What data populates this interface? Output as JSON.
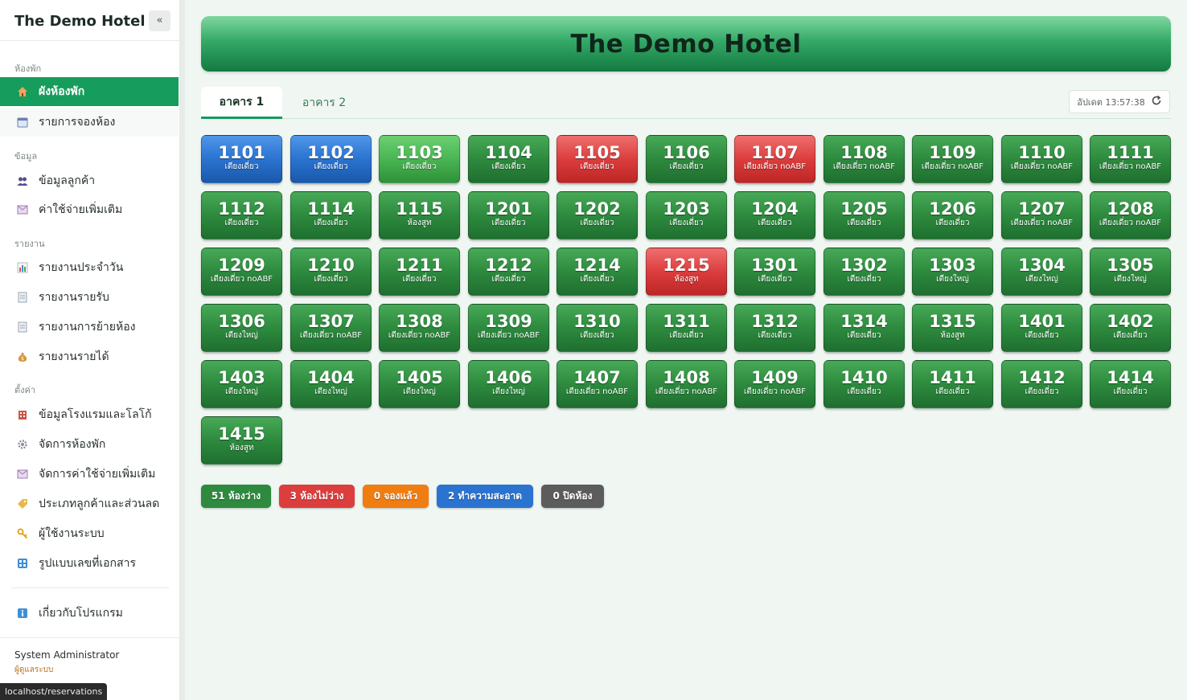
{
  "sidebar": {
    "brand": "The Demo Hotel",
    "collapse": "«",
    "sections": {
      "rooms": "ห้องพัก",
      "data": "ข้อมูล",
      "reports": "รายงาน",
      "settings": "ตั้งค่า"
    },
    "items": [
      {
        "label": "ผังห้องพัก",
        "icon": "house-icon"
      },
      {
        "label": "รายการจองห้อง",
        "icon": "calendar-icon"
      },
      {
        "label": "ข้อมูลลูกค้า",
        "icon": "people-icon"
      },
      {
        "label": "ค่าใช้จ่ายเพิ่มเติม",
        "icon": "receipt-icon"
      },
      {
        "label": "รายงานประจำวัน",
        "icon": "bar-chart-icon"
      },
      {
        "label": "รายงานรายรับ",
        "icon": "document-icon"
      },
      {
        "label": "รายงานการย้ายห้อง",
        "icon": "document-icon"
      },
      {
        "label": "รายงานรายได้",
        "icon": "money-bag-icon"
      },
      {
        "label": "ข้อมูลโรงแรมและโลโก้",
        "icon": "hotel-icon"
      },
      {
        "label": "จัดการห้องพัก",
        "icon": "gear-icon"
      },
      {
        "label": "จัดการค่าใช้จ่ายเพิ่มเติม",
        "icon": "receipt-icon"
      },
      {
        "label": "ประเภทลูกค้าและส่วนลด",
        "icon": "tag-icon"
      },
      {
        "label": "ผู้ใช้งานระบบ",
        "icon": "key-icon"
      },
      {
        "label": "รูปแบบเลขที่เอกสาร",
        "icon": "numbers-icon"
      },
      {
        "label": "เกี่ยวกับโปรแกรม",
        "icon": "info-icon"
      }
    ],
    "user": {
      "name": "System Administrator",
      "role": "ผู้ดูแลระบบ"
    },
    "status_url": "localhost/reservations"
  },
  "header": {
    "title": "The Demo Hotel"
  },
  "tabs": [
    {
      "label": "อาคาร 1"
    },
    {
      "label": "อาคาร 2"
    }
  ],
  "update": {
    "label": "อัปเดต 13:57:38"
  },
  "colors": {
    "available": "#2d8a3e",
    "available_light": "#49b553",
    "occupied": "#dc3d3d",
    "cleaning": "#2a73d0",
    "reserved": "#f07d12",
    "closed": "#5c5c5c",
    "accent": "#169c5c"
  },
  "rooms": [
    {
      "number": "1101",
      "type": "เตียงเดี่ยว",
      "status": "blue"
    },
    {
      "number": "1102",
      "type": "เตียงเดี่ยว",
      "status": "blue"
    },
    {
      "number": "1103",
      "type": "เตียงเดี่ยว",
      "status": "green-light"
    },
    {
      "number": "1104",
      "type": "เตียงเดี่ยว",
      "status": "green"
    },
    {
      "number": "1105",
      "type": "เตียงเดี่ยว",
      "status": "red"
    },
    {
      "number": "1106",
      "type": "เตียงเดี่ยว",
      "status": "green"
    },
    {
      "number": "1107",
      "type": "เตียงเดี่ยว noABF",
      "status": "red"
    },
    {
      "number": "1108",
      "type": "เตียงเดี่ยว noABF",
      "status": "green"
    },
    {
      "number": "1109",
      "type": "เตียงเดี่ยว noABF",
      "status": "green"
    },
    {
      "number": "1110",
      "type": "เตียงเดี่ยว noABF",
      "status": "green"
    },
    {
      "number": "1111",
      "type": "เตียงเดี่ยว noABF",
      "status": "green"
    },
    {
      "number": "1112",
      "type": "เตียงเดี่ยว",
      "status": "green"
    },
    {
      "number": "1114",
      "type": "เตียงเดี่ยว",
      "status": "green"
    },
    {
      "number": "1115",
      "type": "ห้องสูท",
      "status": "green"
    },
    {
      "number": "1201",
      "type": "เตียงเดี่ยว",
      "status": "green"
    },
    {
      "number": "1202",
      "type": "เตียงเดี่ยว",
      "status": "green"
    },
    {
      "number": "1203",
      "type": "เตียงเดี่ยว",
      "status": "green"
    },
    {
      "number": "1204",
      "type": "เตียงเดี่ยว",
      "status": "green"
    },
    {
      "number": "1205",
      "type": "เตียงเดี่ยว",
      "status": "green"
    },
    {
      "number": "1206",
      "type": "เตียงเดี่ยว",
      "status": "green"
    },
    {
      "number": "1207",
      "type": "เตียงเดี่ยว noABF",
      "status": "green"
    },
    {
      "number": "1208",
      "type": "เตียงเดี่ยว noABF",
      "status": "green"
    },
    {
      "number": "1209",
      "type": "เตียงเดี่ยว noABF",
      "status": "green"
    },
    {
      "number": "1210",
      "type": "เตียงเดี่ยว",
      "status": "green"
    },
    {
      "number": "1211",
      "type": "เตียงเดี่ยว",
      "status": "green"
    },
    {
      "number": "1212",
      "type": "เตียงเดี่ยว",
      "status": "green"
    },
    {
      "number": "1214",
      "type": "เตียงเดี่ยว",
      "status": "green"
    },
    {
      "number": "1215",
      "type": "ห้องสูท",
      "status": "red"
    },
    {
      "number": "1301",
      "type": "เตียงเดี่ยว",
      "status": "green"
    },
    {
      "number": "1302",
      "type": "เตียงเดี่ยว",
      "status": "green"
    },
    {
      "number": "1303",
      "type": "เตียงใหญ่",
      "status": "green"
    },
    {
      "number": "1304",
      "type": "เตียงใหญ่",
      "status": "green"
    },
    {
      "number": "1305",
      "type": "เตียงใหญ่",
      "status": "green"
    },
    {
      "number": "1306",
      "type": "เตียงใหญ่",
      "status": "green"
    },
    {
      "number": "1307",
      "type": "เตียงเดี่ยว noABF",
      "status": "green"
    },
    {
      "number": "1308",
      "type": "เตียงเดี่ยว noABF",
      "status": "green"
    },
    {
      "number": "1309",
      "type": "เตียงเดี่ยว noABF",
      "status": "green"
    },
    {
      "number": "1310",
      "type": "เตียงเดี่ยว",
      "status": "green"
    },
    {
      "number": "1311",
      "type": "เตียงเดี่ยว",
      "status": "green"
    },
    {
      "number": "1312",
      "type": "เตียงเดี่ยว",
      "status": "green"
    },
    {
      "number": "1314",
      "type": "เตียงเดี่ยว",
      "status": "green"
    },
    {
      "number": "1315",
      "type": "ห้องสูท",
      "status": "green"
    },
    {
      "number": "1401",
      "type": "เตียงเดี่ยว",
      "status": "green"
    },
    {
      "number": "1402",
      "type": "เตียงเดี่ยว",
      "status": "green"
    },
    {
      "number": "1403",
      "type": "เตียงใหญ่",
      "status": "green"
    },
    {
      "number": "1404",
      "type": "เตียงใหญ่",
      "status": "green"
    },
    {
      "number": "1405",
      "type": "เตียงใหญ่",
      "status": "green"
    },
    {
      "number": "1406",
      "type": "เตียงใหญ่",
      "status": "green"
    },
    {
      "number": "1407",
      "type": "เตียงเดี่ยว noABF",
      "status": "green"
    },
    {
      "number": "1408",
      "type": "เตียงเดี่ยว noABF",
      "status": "green"
    },
    {
      "number": "1409",
      "type": "เตียงเดี่ยว noABF",
      "status": "green"
    },
    {
      "number": "1410",
      "type": "เตียงเดี่ยว",
      "status": "green"
    },
    {
      "number": "1411",
      "type": "เตียงเดี่ยว",
      "status": "green"
    },
    {
      "number": "1412",
      "type": "เตียงเดี่ยว",
      "status": "green"
    },
    {
      "number": "1414",
      "type": "เตียงเดี่ยว",
      "status": "green"
    },
    {
      "number": "1415",
      "type": "ห้องสูท",
      "status": "green"
    }
  ],
  "legend": [
    {
      "label": "51 ห้องว่าง",
      "color": "#2d8a3e"
    },
    {
      "label": "3 ห้องไม่ว่าง",
      "color": "#dc3d3d"
    },
    {
      "label": "0 จองแล้ว",
      "color": "#f07d12"
    },
    {
      "label": "2 ทำความสะอาด",
      "color": "#2a73d0"
    },
    {
      "label": "0 ปิดห้อง",
      "color": "#5c5c5c"
    }
  ]
}
